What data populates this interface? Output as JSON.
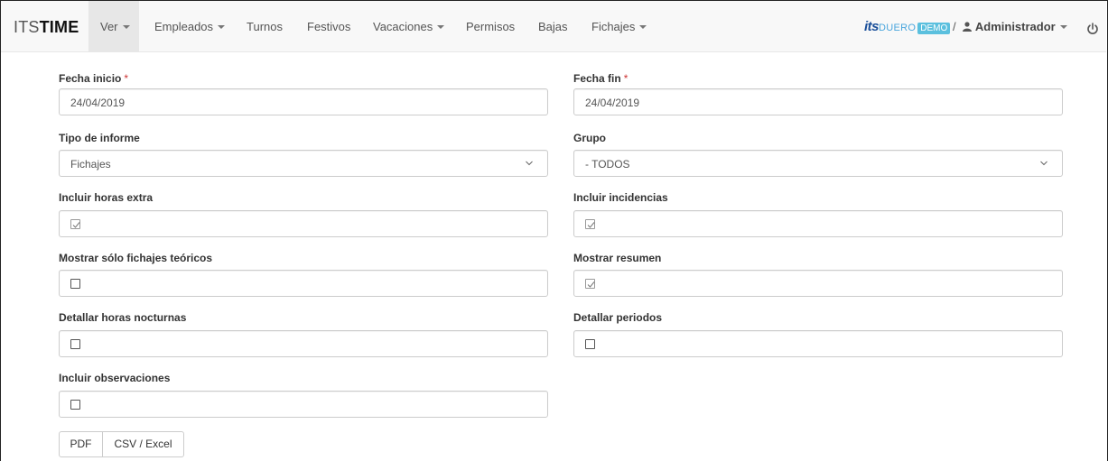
{
  "navbar": {
    "brand_light": "ITS",
    "brand_bold": "TIME",
    "items": [
      {
        "label": "Ver",
        "dropdown": true,
        "active": true
      },
      {
        "label": "Empleados",
        "dropdown": true
      },
      {
        "label": "Turnos",
        "dropdown": false
      },
      {
        "label": "Festivos",
        "dropdown": false
      },
      {
        "label": "Vacaciones",
        "dropdown": true
      },
      {
        "label": "Permisos",
        "dropdown": false
      },
      {
        "label": "Bajas",
        "dropdown": false
      },
      {
        "label": "Fichajes",
        "dropdown": true
      }
    ],
    "logo": {
      "its": "its",
      "duero": "DUERO",
      "demo": "DEMO"
    },
    "separator": "/",
    "user": "Administrador",
    "icons": {
      "user": "user-icon",
      "power": "power-icon"
    }
  },
  "form": {
    "fecha_inicio": {
      "label": "Fecha inicio",
      "required_mark": "*",
      "value": "24/04/2019"
    },
    "fecha_fin": {
      "label": "Fecha fin",
      "required_mark": "*",
      "value": "24/04/2019"
    },
    "tipo_informe": {
      "label": "Tipo de informe",
      "value": "Fichajes"
    },
    "grupo": {
      "label": "Grupo",
      "value": "- TODOS"
    },
    "incluir_horas_extra": {
      "label": "Incluir horas extra",
      "checked": true
    },
    "incluir_incidencias": {
      "label": "Incluir incidencias",
      "checked": true
    },
    "mostrar_solo_teoricos": {
      "label": "Mostrar sólo fichajes teóricos",
      "checked": false
    },
    "mostrar_resumen": {
      "label": "Mostrar resumen",
      "checked": true
    },
    "detallar_horas_nocturnas": {
      "label": "Detallar horas nocturnas",
      "checked": false
    },
    "detallar_periodos": {
      "label": "Detallar periodos",
      "checked": false
    },
    "incluir_observaciones": {
      "label": "Incluir observaciones",
      "checked": false
    }
  },
  "buttons": {
    "pdf": "PDF",
    "csv": "CSV / Excel"
  },
  "colors": {
    "navbar_bg": "#f8f8f8",
    "active_tab": "#e7e7e7",
    "required": "#cc3333",
    "logo_its": "#1a4f9a",
    "logo_demo": "#5bc0de"
  }
}
